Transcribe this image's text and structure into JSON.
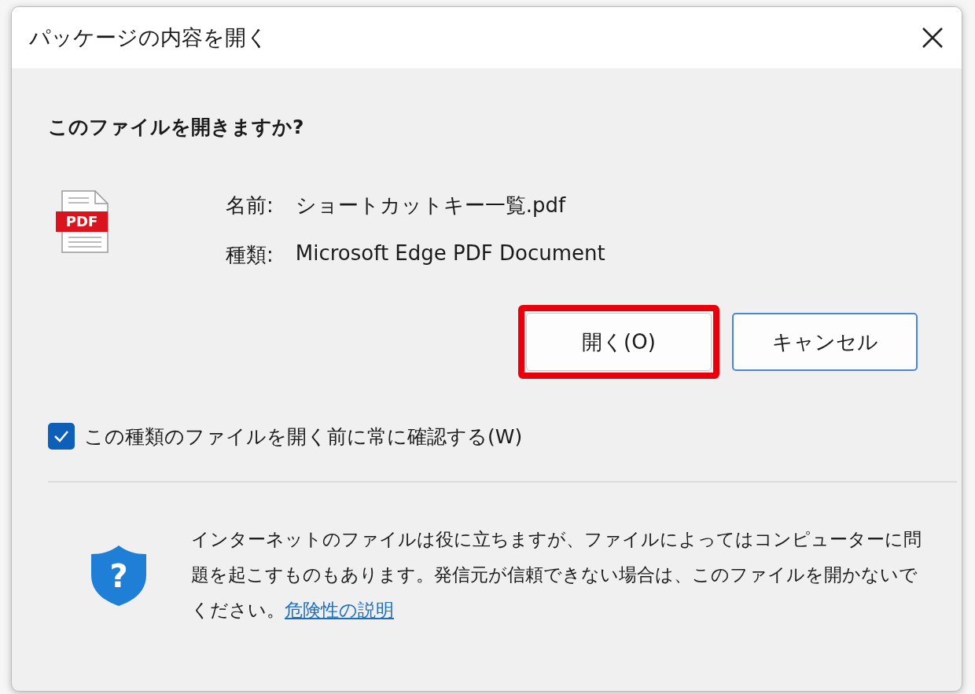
{
  "window": {
    "title": "パッケージの内容を開く"
  },
  "heading": "このファイルを開きますか?",
  "file": {
    "icon_label": "PDF",
    "fields": [
      {
        "label": "名前:",
        "value": "ショートカットキー一覧.pdf"
      },
      {
        "label": "種類:",
        "value": "Microsoft Edge PDF Document"
      }
    ]
  },
  "buttons": [
    {
      "label": "開く(O)",
      "focused": false,
      "highlighted": true
    },
    {
      "label": "キャンセル",
      "focused": true,
      "highlighted": false
    }
  ],
  "checkbox": {
    "label": "この種類のファイルを開く前に常に確認する(W)",
    "checked": true
  },
  "footer": {
    "icon_glyph": "?",
    "text": "インターネットのファイルは役に立ちますが、ファイルによってはコンピューターに問題を起こすものもあります。発信元が信頼できない場合は、このファイルを開かないでください。",
    "link": "危険性の説明"
  }
}
